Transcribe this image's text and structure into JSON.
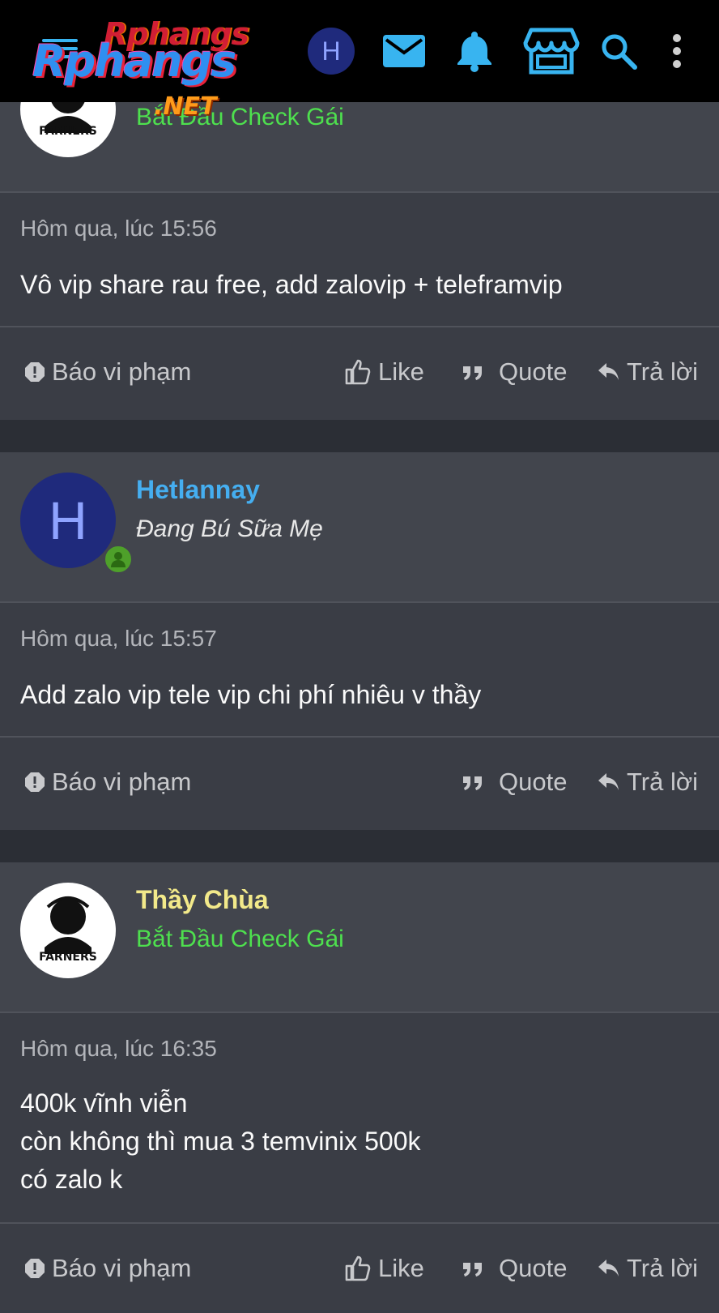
{
  "header": {
    "logo_text": "Rphangs",
    "logo_suffix": ".NET",
    "avatar_letter": "H",
    "icons": [
      "menu-icon",
      "mail-icon",
      "bell-icon",
      "store-icon",
      "search-icon",
      "more-vertical-icon"
    ],
    "accent_color": "#38b4f0"
  },
  "posts": [
    {
      "user_title": "Bắt Đầu Check Gái",
      "timestamp": "Hôm qua, lúc 15:56",
      "lines": [
        "Vô vip share rau free, add zalovip + teleframvip"
      ],
      "actions": {
        "report": "Báo vi phạm",
        "like": "Like",
        "quote": "Quote",
        "reply": "Trả lời"
      }
    },
    {
      "username": "Hetlannay",
      "avatar_letter": "H",
      "user_title": "Đang Bú Sữa Mẹ",
      "timestamp": "Hôm qua, lúc 15:57",
      "lines": [
        "Add zalo vip tele vip chi phí nhiêu v thầy"
      ],
      "actions": {
        "report": "Báo vi phạm",
        "quote": "Quote",
        "reply": "Trả lời"
      }
    },
    {
      "username": "Thầy Chùa",
      "avatar_text": "FARNERS",
      "user_title": "Bắt Đầu Check Gái",
      "timestamp": "Hôm qua, lúc 16:35",
      "lines": [
        "400k vĩnh viễn",
        "còn không thì mua 3 temvinix 500k",
        "có zalo k"
      ],
      "actions": {
        "report": "Báo vi phạm",
        "like": "Like",
        "quote": "Quote",
        "reply": "Trả lời"
      }
    }
  ],
  "colors": {
    "username_blue": "#45aef0",
    "username_yellow": "#f2e98a",
    "title_green": "#4ee04e"
  }
}
